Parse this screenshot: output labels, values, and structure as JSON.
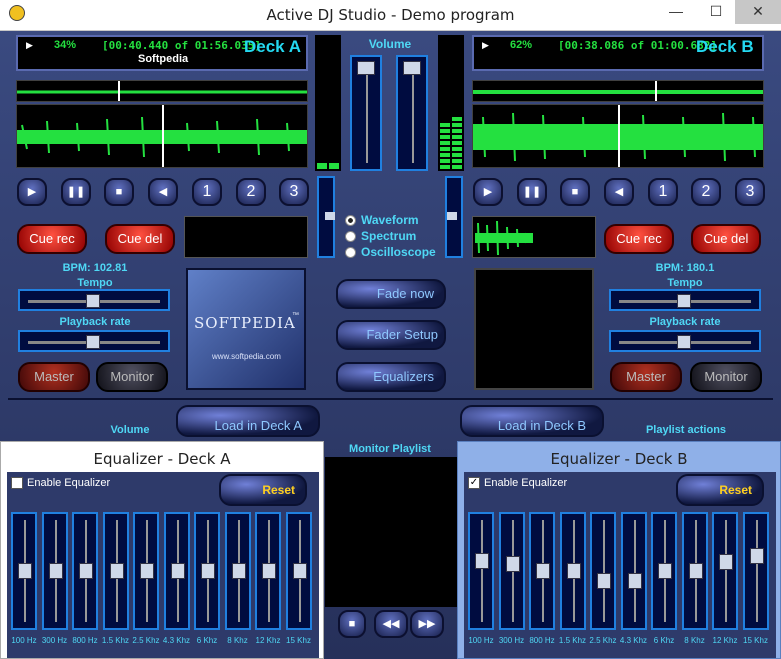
{
  "window": {
    "title": "Active DJ Studio - Demo program",
    "minimize": "—",
    "maximize": "☐",
    "close": "✕"
  },
  "deckA": {
    "percent": "34%",
    "time": "[00:40.440 of 01:56.035]",
    "name": "Deck A",
    "track": "Softpedia",
    "bpm": "BPM: 102.81",
    "tempo_label": "Tempo",
    "rate_label": "Playback rate",
    "cue_rec": "Cue rec",
    "cue_del": "Cue del",
    "master": "Master",
    "monitor": "Monitor",
    "load": "Load in Deck A",
    "hotcues": [
      "1",
      "2",
      "3"
    ],
    "tempo_level": 0.5,
    "rate_level": 0.5
  },
  "deckB": {
    "percent": "62%",
    "time": "[00:38.086 of 01:00.682]",
    "name": "Deck B",
    "bpm": "BPM: 180.1",
    "tempo_label": "Tempo",
    "rate_label": "Playback rate",
    "cue_rec": "Cue rec",
    "cue_del": "Cue del",
    "master": "Master",
    "monitor": "Monitor",
    "load": "Load in Deck B",
    "hotcues": [
      "1",
      "2",
      "3"
    ],
    "tempo_level": 0.5,
    "rate_level": 0.5
  },
  "mixer": {
    "volume_label": "Volume",
    "view_options": [
      "Waveform",
      "Spectrum",
      "Oscilloscope"
    ],
    "selected_view": "Waveform",
    "fade_now": "Fade now",
    "fader_setup": "Fader Setup",
    "equalizers": "Equalizers"
  },
  "logo": {
    "text": "SOFTPEDIA",
    "tm": "™",
    "url": "www.softpedia.com"
  },
  "bottom": {
    "volume_label": "Volume",
    "playlist_actions": "Playlist actions",
    "monitor_playlist": "Monitor Playlist"
  },
  "eqA": {
    "title": "Equalizer - Deck A",
    "enable": "Enable Equalizer",
    "enabled": false,
    "reset": "Reset"
  },
  "eqB": {
    "title": "Equalizer - Deck B",
    "enable": "Enable Equalizer",
    "enabled": true,
    "reset": "Reset"
  },
  "bands": [
    "100 Hz",
    "300 Hz",
    "800 Hz",
    "1.5 Khz",
    "2.5 Khz",
    "4.3 Khz",
    "6 Khz",
    "8 Khz",
    "12 Khz",
    "15 Khz"
  ],
  "eqA_levels": [
    0.5,
    0.5,
    0.5,
    0.5,
    0.5,
    0.5,
    0.5,
    0.5,
    0.5,
    0.5
  ],
  "eqB_levels": [
    0.62,
    0.58,
    0.5,
    0.5,
    0.38,
    0.38,
    0.5,
    0.5,
    0.6,
    0.68
  ],
  "icons": {
    "play": "▶",
    "pause": "❚❚",
    "stop": "■",
    "prev": "◀",
    "rew": "◀◀",
    "fwd": "▶▶"
  },
  "colors": {
    "accent": "#4fd8f5",
    "wave": "#24e040",
    "cue": "#d02010",
    "reset": "#ffd020"
  }
}
